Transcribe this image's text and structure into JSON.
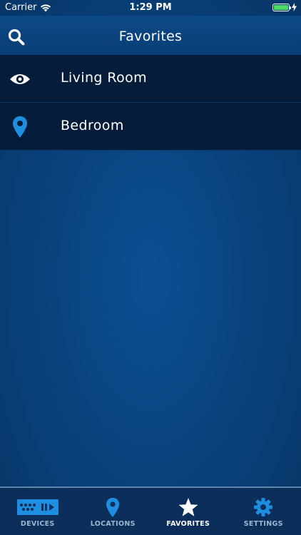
{
  "status_bar": {
    "carrier": "Carrier",
    "time": "1:29 PM",
    "battery_level": 1.0
  },
  "nav": {
    "title": "Favorites",
    "search_icon": "search-icon"
  },
  "favorites": [
    {
      "label": "Living Room",
      "icon": "eye-icon"
    },
    {
      "label": "Bedroom",
      "icon": "location-pin-icon"
    }
  ],
  "tabs": [
    {
      "label": "DEVICES",
      "icon": "devices-icon",
      "active": false
    },
    {
      "label": "LOCATIONS",
      "icon": "location-pin-icon",
      "active": false
    },
    {
      "label": "FAVORITES",
      "icon": "star-icon",
      "active": true
    },
    {
      "label": "SETTINGS",
      "icon": "gear-icon",
      "active": false
    }
  ],
  "colors": {
    "accent": "#1e8fe0",
    "background": "#0a4582",
    "row_background": "#051d3a",
    "battery_green": "#4cd964"
  }
}
